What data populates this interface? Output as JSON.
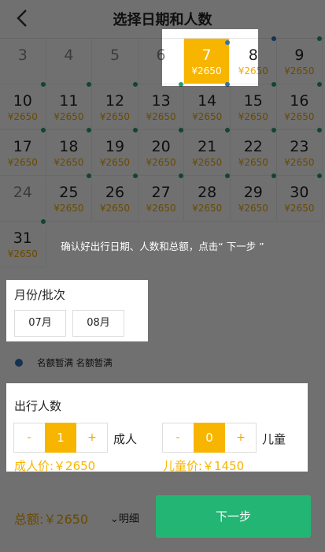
{
  "header": {
    "title": "选择日期和人数"
  },
  "calendar": {
    "cells": [
      {
        "day": "3",
        "price": "",
        "state": "disabled"
      },
      {
        "day": "4",
        "price": "",
        "state": "disabled"
      },
      {
        "day": "5",
        "price": "",
        "state": "disabled"
      },
      {
        "day": "6",
        "price": "",
        "state": "disabled"
      },
      {
        "day": "7",
        "price": "¥2650",
        "state": "selected",
        "dots": [
          "b",
          "g"
        ]
      },
      {
        "day": "8",
        "price": "¥2650",
        "state": "available",
        "dots": [
          "b"
        ]
      },
      {
        "day": "9",
        "price": "¥2650",
        "state": "available",
        "dots": [
          "g"
        ]
      },
      {
        "day": "10",
        "price": "¥2650",
        "state": "available",
        "dots": [
          "g"
        ]
      },
      {
        "day": "11",
        "price": "¥2650",
        "state": "available",
        "dots": [
          "g"
        ]
      },
      {
        "day": "12",
        "price": "¥2650",
        "state": "available",
        "dots": [
          "g"
        ]
      },
      {
        "day": "13",
        "price": "¥2650",
        "state": "available",
        "dots": [
          "g"
        ]
      },
      {
        "day": "14",
        "price": "¥2650",
        "state": "available",
        "dots": [
          "b"
        ]
      },
      {
        "day": "15",
        "price": "¥2650",
        "state": "available",
        "dots": [
          "g"
        ]
      },
      {
        "day": "16",
        "price": "¥2650",
        "state": "available",
        "dots": [
          "g"
        ]
      },
      {
        "day": "17",
        "price": "¥2650",
        "state": "available",
        "dots": [
          "g"
        ]
      },
      {
        "day": "18",
        "price": "¥2650",
        "state": "available",
        "dots": [
          "g"
        ]
      },
      {
        "day": "19",
        "price": "¥2650",
        "state": "available",
        "dots": [
          "g"
        ]
      },
      {
        "day": "20",
        "price": "¥2650",
        "state": "available",
        "dots": [
          "g"
        ]
      },
      {
        "day": "21",
        "price": "¥2650",
        "state": "available",
        "dots": [
          "g"
        ]
      },
      {
        "day": "22",
        "price": "¥2650",
        "state": "available",
        "dots": [
          "g"
        ]
      },
      {
        "day": "23",
        "price": "¥2650",
        "state": "available",
        "dots": [
          "g"
        ]
      },
      {
        "day": "24",
        "price": "",
        "state": "disabled"
      },
      {
        "day": "25",
        "price": "¥2650",
        "state": "available",
        "dots": [
          "g"
        ]
      },
      {
        "day": "26",
        "price": "¥2650",
        "state": "available",
        "dots": [
          "g"
        ]
      },
      {
        "day": "27",
        "price": "¥2650",
        "state": "available",
        "dots": [
          "g"
        ]
      },
      {
        "day": "28",
        "price": "¥2650",
        "state": "available",
        "dots": [
          "g"
        ]
      },
      {
        "day": "29",
        "price": "¥2650",
        "state": "available",
        "dots": [
          "g"
        ]
      },
      {
        "day": "30",
        "price": "¥2650",
        "state": "available",
        "dots": [
          "g"
        ]
      },
      {
        "day": "31",
        "price": "¥2650",
        "state": "available",
        "dots": [
          "g"
        ]
      }
    ]
  },
  "hint": "确认好出行日期、人数和总额，点击“ 下一步 ”",
  "month": {
    "label": "月份/批次",
    "options": [
      "07月",
      "08月"
    ]
  },
  "legend": {
    "text": "名额暂满 名额暂满"
  },
  "travelers": {
    "label": "出行人数",
    "adult": {
      "minus": "-",
      "count": "1",
      "plus": "+",
      "unit": "成人",
      "price": "成人价:￥2650"
    },
    "child": {
      "minus": "-",
      "count": "0",
      "plus": "+",
      "unit": "儿童",
      "price": "儿童价:￥1450"
    }
  },
  "footer": {
    "total": "总额:￥2650",
    "detail": "明细",
    "next": "下一步"
  },
  "colors": {
    "accent": "#f7b500",
    "green": "#22b573",
    "blue": "#2e73b8"
  }
}
